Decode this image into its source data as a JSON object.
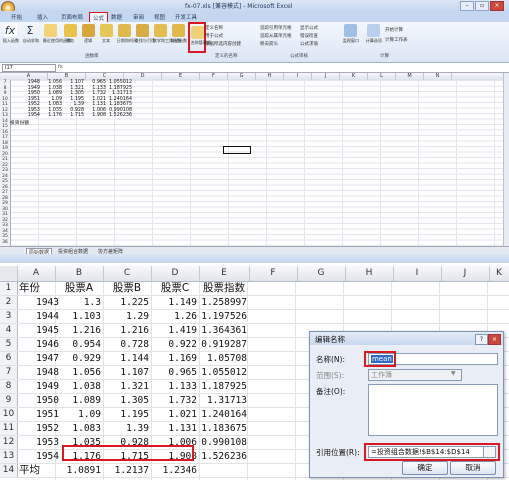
{
  "top": {
    "window_title": "fx-07.xls [兼容模式] - Microsoft Excel",
    "window_buttons": [
      "–",
      "▫",
      "×"
    ],
    "tabs": [
      "开始",
      "插入",
      "页面布局",
      "公式",
      "数据",
      "审阅",
      "视图",
      "开发工具"
    ],
    "active_tab": 3,
    "ribbon": {
      "buttons": [
        "插入函数",
        "自动求和",
        "最近使用的函数",
        "财务",
        "逻辑",
        "文本",
        "日期和时间",
        "查找与引用",
        "数学和三角函数",
        "其他函数",
        "名称管理器"
      ],
      "name_items": [
        "定义名称",
        "用于公式",
        "根据所选内容创建"
      ],
      "audit_items": [
        "追踪引用单元格",
        "追踪从属单元格",
        "移去箭头",
        "显示公式",
        "错误检查",
        "公式求值"
      ],
      "watch": "监视窗口",
      "calc_items": [
        "计算选项",
        "开始计算",
        "计算工作表"
      ],
      "groups": [
        "函数库",
        "定义的名称",
        "公式审核",
        "计算"
      ]
    },
    "namebox": "I17",
    "columns": [
      "A",
      "B",
      "C",
      "D",
      "E",
      "F",
      "G",
      "H",
      "I",
      "J",
      "K",
      "L",
      "M",
      "N"
    ],
    "rows": [
      {
        "n": "7",
        "a": "1948",
        "b": "1.056",
        "c": "1.107",
        "d": "0.965",
        "e": "1.055012"
      },
      {
        "n": "8",
        "a": "1949",
        "b": "1.038",
        "c": "1.321",
        "d": "1.133",
        "e": "1.187925"
      },
      {
        "n": "9",
        "a": "1950",
        "b": "1.089",
        "c": "1.305",
        "d": "1.732",
        "e": "1.31713"
      },
      {
        "n": "10",
        "a": "1951",
        "b": "1.09",
        "c": "1.195",
        "d": "1.021",
        "e": "1.240164"
      },
      {
        "n": "11",
        "a": "1952",
        "b": "1.083",
        "c": "1.39",
        "d": "1.131",
        "e": "1.183675"
      },
      {
        "n": "12",
        "a": "1953",
        "b": "1.035",
        "c": "0.928",
        "d": "1.006",
        "e": "0.990108"
      },
      {
        "n": "13",
        "a": "1954",
        "b": "1.176",
        "c": "1.715",
        "d": "1.908",
        "e": "1.526236"
      },
      {
        "n": "14",
        "a": "投资份额",
        "b": "",
        "c": "",
        "d": "",
        "e": ""
      }
    ],
    "empty_rows": [
      "15",
      "16",
      "17",
      "18",
      "19",
      "20",
      "21",
      "22",
      "23",
      "24",
      "25",
      "26",
      "27",
      "28",
      "29",
      "30",
      "31",
      "32",
      "33",
      "34",
      "35",
      "36"
    ],
    "sheet_tabs": [
      "原始数据",
      "投资组合数据",
      "协方差矩阵"
    ]
  },
  "bottom": {
    "columns": [
      "A",
      "B",
      "C",
      "D",
      "E",
      "F",
      "G",
      "H",
      "I",
      "J",
      "K"
    ],
    "header_row": {
      "n": "1",
      "a": "年份",
      "b": "股票A",
      "c": "股票B",
      "d": "股票C",
      "e": "股票指数"
    },
    "rows": [
      {
        "n": "2",
        "a": "1943",
        "b": "1.3",
        "c": "1.225",
        "d": "1.149",
        "e": "1.258997"
      },
      {
        "n": "3",
        "a": "1944",
        "b": "1.103",
        "c": "1.29",
        "d": "1.26",
        "e": "1.197526"
      },
      {
        "n": "4",
        "a": "1945",
        "b": "1.216",
        "c": "1.216",
        "d": "1.419",
        "e": "1.364361"
      },
      {
        "n": "5",
        "a": "1946",
        "b": "0.954",
        "c": "0.728",
        "d": "0.922",
        "e": "0.919287"
      },
      {
        "n": "6",
        "a": "1947",
        "b": "0.929",
        "c": "1.144",
        "d": "1.169",
        "e": "1.05708"
      },
      {
        "n": "7",
        "a": "1948",
        "b": "1.056",
        "c": "1.107",
        "d": "0.965",
        "e": "1.055012"
      },
      {
        "n": "8",
        "a": "1949",
        "b": "1.038",
        "c": "1.321",
        "d": "1.133",
        "e": "1.187925"
      },
      {
        "n": "9",
        "a": "1950",
        "b": "1.089",
        "c": "1.305",
        "d": "1.732",
        "e": "1.31713"
      },
      {
        "n": "10",
        "a": "1951",
        "b": "1.09",
        "c": "1.195",
        "d": "1.021",
        "e": "1.240164"
      },
      {
        "n": "11",
        "a": "1952",
        "b": "1.083",
        "c": "1.39",
        "d": "1.131",
        "e": "1.183675"
      },
      {
        "n": "12",
        "a": "1953",
        "b": "1.035",
        "c": "0.928",
        "d": "1.006",
        "e": "0.990108"
      },
      {
        "n": "13",
        "a": "1954",
        "b": "1.176",
        "c": "1.715",
        "d": "1.908",
        "e": "1.526236"
      }
    ],
    "avg_row": {
      "n": "14",
      "a": "平均",
      "b": "1.0891",
      "c": "1.2137",
      "d": "1.2346"
    }
  },
  "dialog": {
    "title": "编辑名称",
    "help": "?",
    "close": "×",
    "name_label": "名称(N):",
    "name_value": "mean",
    "scope_label": "范围(S):",
    "scope_value": "工作簿",
    "comment_label": "备注(O):",
    "ref_label": "引用位置(R):",
    "ref_value": "=投资组合数据!$B$14:$D$14",
    "ok": "确定",
    "cancel": "取消"
  },
  "accent": {
    "highlight": "#d9181f",
    "ribbon": "#dbe6f4"
  }
}
